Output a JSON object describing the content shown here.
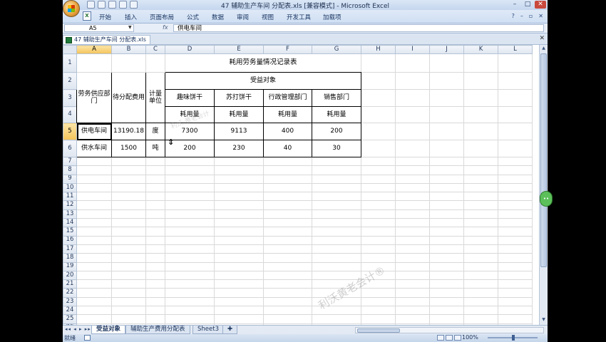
{
  "window": {
    "title": "47 辅助生产车间  分配表.xls  [兼容模式] - Microsoft Excel",
    "controls": [
      "–",
      "□",
      "✕"
    ]
  },
  "ribbon": {
    "tabs": [
      "开始",
      "插入",
      "页面布局",
      "公式",
      "数据",
      "审阅",
      "视图",
      "开发工具",
      "加载项"
    ]
  },
  "formula_bar": {
    "name_box": "A5",
    "fx": "fx",
    "content": "供电车间"
  },
  "document_tab": {
    "label": "47 辅助生产车间  分配表.xls"
  },
  "sheet": {
    "columns": [
      "A",
      "B",
      "C",
      "D",
      "E",
      "F",
      "G",
      "H",
      "I",
      "J",
      "K",
      "L"
    ],
    "selected_column": "A",
    "selected_row": "5",
    "table_title": "耗用劳务量情况记录表",
    "header": {
      "provider": "劳务供应部门",
      "amount": "待分配费用",
      "unit": "计量单位",
      "beneficiary": "受益对象",
      "dept1": "趣味饼干",
      "dept2": "苏打饼干",
      "dept3": "行政管理部门",
      "dept4": "销售部门",
      "usage": "耗用量"
    },
    "rows": [
      {
        "name": "供电车间",
        "amount": "13190.18",
        "unit": "度",
        "d1": "7300",
        "d2": "9113",
        "d3": "400",
        "d4": "200"
      },
      {
        "name": "供水车间",
        "amount": "1500",
        "unit": "吨",
        "d1": "200",
        "d2": "230",
        "d3": "40",
        "d4": "30"
      }
    ]
  },
  "sheet_tabs": {
    "nav": "◂◂ ◂ ▸ ▸▸",
    "tabs": [
      "受益对象",
      "辅助生产费用分配表",
      "Sheet3"
    ]
  },
  "status": {
    "ready": "就绪",
    "zoom": "100%"
  },
  "watermarks": {
    "main": "利沃黄老会计®",
    "cell": "利沃·黄老会计"
  }
}
